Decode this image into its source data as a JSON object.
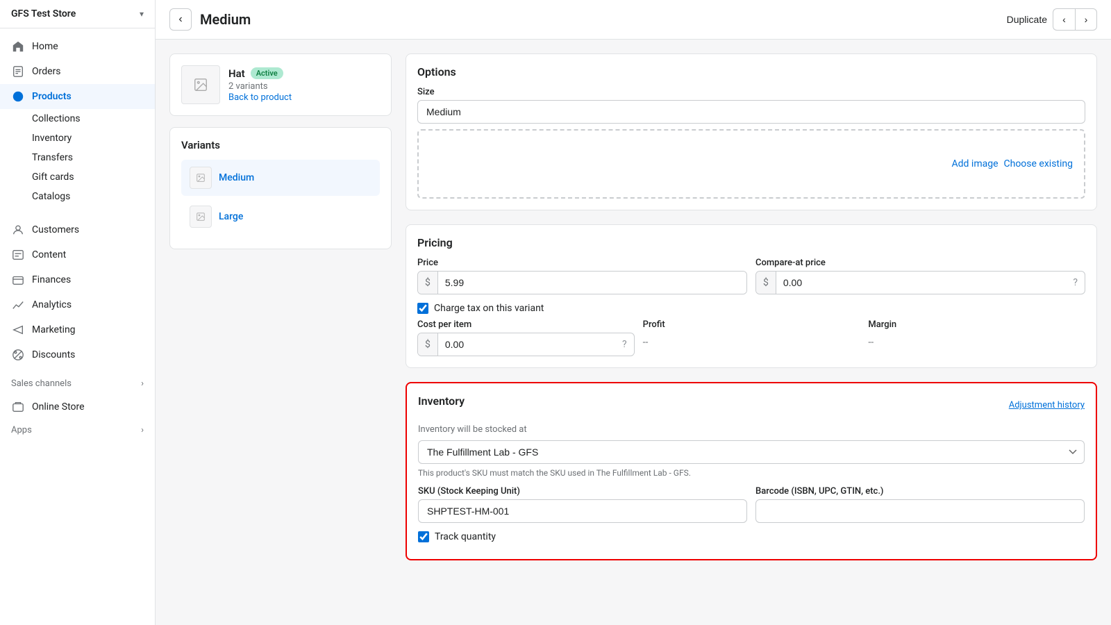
{
  "store": {
    "name": "GFS Test Store"
  },
  "sidebar": {
    "nav_items": [
      {
        "id": "home",
        "label": "Home",
        "icon": "home"
      },
      {
        "id": "orders",
        "label": "Orders",
        "icon": "orders"
      },
      {
        "id": "products",
        "label": "Products",
        "icon": "products",
        "active": true
      }
    ],
    "products_sub": [
      {
        "id": "collections",
        "label": "Collections"
      },
      {
        "id": "inventory",
        "label": "Inventory"
      },
      {
        "id": "transfers",
        "label": "Transfers"
      },
      {
        "id": "gift-cards",
        "label": "Gift cards"
      },
      {
        "id": "catalogs",
        "label": "Catalogs"
      }
    ],
    "other_nav": [
      {
        "id": "customers",
        "label": "Customers",
        "icon": "customers"
      },
      {
        "id": "content",
        "label": "Content",
        "icon": "content"
      },
      {
        "id": "finances",
        "label": "Finances",
        "icon": "finances"
      },
      {
        "id": "analytics",
        "label": "Analytics",
        "icon": "analytics"
      },
      {
        "id": "marketing",
        "label": "Marketing",
        "icon": "marketing"
      },
      {
        "id": "discounts",
        "label": "Discounts",
        "icon": "discounts"
      }
    ],
    "sales_channels_label": "Sales channels",
    "online_store_label": "Online Store",
    "apps_label": "Apps"
  },
  "topbar": {
    "title": "Medium",
    "duplicate_label": "Duplicate"
  },
  "product_card": {
    "name": "Hat",
    "status": "Active",
    "variants_count": "2 variants",
    "back_link": "Back to product"
  },
  "variants_card": {
    "title": "Variants",
    "items": [
      {
        "id": "medium",
        "label": "Medium",
        "active": true
      },
      {
        "id": "large",
        "label": "Large",
        "active": false
      }
    ]
  },
  "options": {
    "title": "Options",
    "size_label": "Size",
    "size_value": "Medium",
    "add_image_label": "Add image",
    "choose_existing_label": "Choose existing"
  },
  "pricing": {
    "title": "Pricing",
    "price_label": "Price",
    "price_currency": "$",
    "price_value": "5.99",
    "compare_label": "Compare-at price",
    "compare_currency": "$",
    "compare_value": "0.00",
    "charge_tax_label": "Charge tax on this variant",
    "cost_label": "Cost per item",
    "cost_currency": "$",
    "cost_value": "0.00",
    "profit_label": "Profit",
    "profit_value": "--",
    "margin_label": "Margin",
    "margin_value": "--"
  },
  "inventory": {
    "title": "Inventory",
    "adjustment_label": "Adjustment history",
    "stocked_at_label": "Inventory will be stocked at",
    "location_value": "The Fulfillment Lab - GFS",
    "warning_text": "This product's SKU must match the SKU used in The Fulfillment Lab - GFS.",
    "sku_label": "SKU (Stock Keeping Unit)",
    "sku_value": "SHPTEST-HM-001",
    "barcode_label": "Barcode (ISBN, UPC, GTIN, etc.)",
    "barcode_value": "",
    "track_quantity_label": "Track quantity"
  }
}
